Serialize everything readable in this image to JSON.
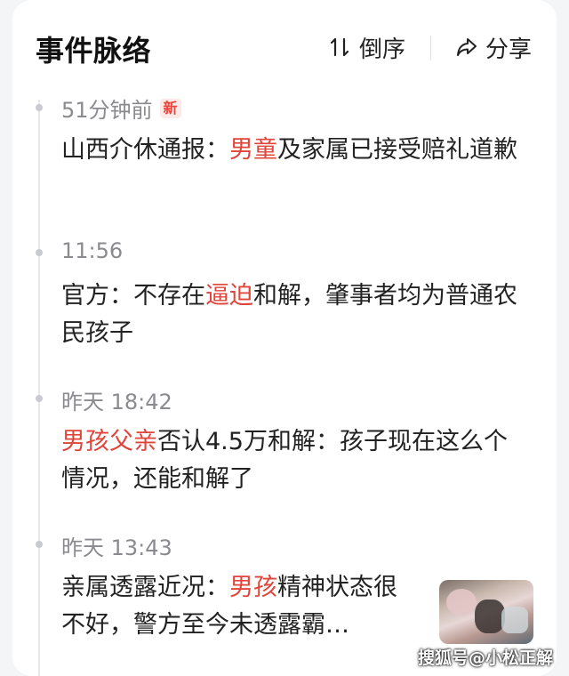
{
  "header": {
    "title": "事件脉络",
    "sort_label": "倒序",
    "share_label": "分享"
  },
  "timeline": [
    {
      "time": "51分钟前",
      "badge": "新",
      "segments": [
        {
          "text": "山西介休通报：",
          "hl": false
        },
        {
          "text": "男童",
          "hl": true
        },
        {
          "text": "及家属已接受赔礼道歉",
          "hl": false
        }
      ]
    },
    {
      "time": "11:56",
      "segments": [
        {
          "text": "官方：不存在",
          "hl": false
        },
        {
          "text": "逼迫",
          "hl": true
        },
        {
          "text": "和解，肇事者均为普通农民孩子",
          "hl": false
        }
      ]
    },
    {
      "time": "昨天 18:42",
      "segments": [
        {
          "text": "男孩父亲",
          "hl": true
        },
        {
          "text": "否认4.5万和解：孩子现在这么个情况，还能和解了",
          "hl": false
        }
      ]
    },
    {
      "time": "昨天 13:43",
      "segments": [
        {
          "text": "亲属透露近况：",
          "hl": false
        },
        {
          "text": "男孩",
          "hl": true
        },
        {
          "text": "精神状态很不好，警方至今未透露霸…",
          "hl": false
        }
      ]
    }
  ],
  "watermark": "搜狐号@小松正解",
  "colors": {
    "highlight": "#e0453b",
    "badge_text": "#e8453c",
    "badge_bg": "#fde9e7",
    "time": "#8a8a8f"
  }
}
